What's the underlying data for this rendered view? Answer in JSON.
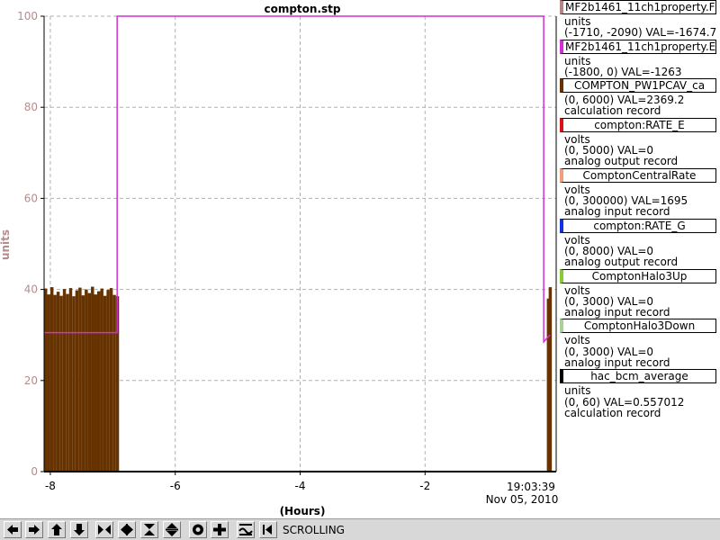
{
  "window": {
    "title": "compton.stp"
  },
  "chart_data": {
    "type": "line",
    "title": "compton.stp",
    "xlabel": "(Hours)",
    "ylabel": "units",
    "xlim": [
      -8.1,
      0.1
    ],
    "ylim": [
      0,
      100
    ],
    "x_ticks": [
      -8,
      -6,
      -4,
      -2
    ],
    "x_tick_labels": [
      "-8",
      "-6",
      "-4",
      "-2"
    ],
    "y_ticks": [
      0,
      20,
      40,
      60,
      80,
      100
    ],
    "y_tick_labels": [
      "0",
      "20",
      "40",
      "60",
      "80",
      "100"
    ],
    "grid": true,
    "legend": "right",
    "end_time": "19:03:39",
    "end_date": "Nov 05, 2010",
    "colors": {
      "axis_label": "#b48c8c",
      "line": "#d42ed4",
      "bars": "#663300"
    },
    "series": [
      {
        "name": "MF2b1461_11ch1property.E",
        "color": "#d42ed4",
        "x": [
          -8.1,
          -6.93,
          -6.93,
          -0.1,
          -0.1,
          0.0
        ],
        "y": [
          30.5,
          30.5,
          100,
          100,
          28.5,
          30
        ]
      },
      {
        "name": "COMPTON_PW1PCAV_ca",
        "color": "#663300",
        "x": [
          -8.1,
          -8.05,
          -8.0,
          -7.95,
          -7.9,
          -7.85,
          -7.8,
          -7.75,
          -7.7,
          -7.65,
          -7.6,
          -7.55,
          -7.5,
          -7.45,
          -7.4,
          -7.35,
          -7.3,
          -7.25,
          -7.2,
          -7.15,
          -7.1,
          -7.05,
          -7.0,
          -6.95,
          -0.05,
          -0.02
        ],
        "y": [
          40.2,
          38.9,
          40.5,
          38.8,
          39.5,
          38.6,
          40.1,
          39.0,
          40.3,
          38.5,
          39.8,
          40.4,
          38.7,
          40.0,
          39.2,
          40.6,
          38.9,
          39.6,
          40.2,
          38.6,
          39.9,
          40.3,
          38.8,
          38.5,
          38.0,
          40.5
        ]
      }
    ]
  },
  "legend": [
    {
      "name": "MF2b1461_11ch1property.F",
      "color": "#b88585",
      "lines": [
        "units",
        "(-1710, -2090) VAL=-1674.7"
      ]
    },
    {
      "name": "MF2b1461_11ch1property.E",
      "color": "#d42ed4",
      "lines": [
        "units",
        "(-1800, 0) VAL=-1263"
      ]
    },
    {
      "name": "COMPTON_PW1PCAV_ca",
      "color": "#663300",
      "lines": [
        "(0, 6000) VAL=2369.2",
        "calculation record"
      ]
    },
    {
      "name": "compton:RATE_E",
      "color": "#dd1111",
      "lines": [
        "volts",
        "(0, 5000) VAL=0",
        "analog output record"
      ]
    },
    {
      "name": "ComptonCentralRate",
      "color": "#f0a078",
      "lines": [
        "volts",
        "(0, 300000) VAL=1695",
        "analog input record"
      ]
    },
    {
      "name": "compton:RATE_G",
      "color": "#1133dd",
      "lines": [
        "volts",
        "(0, 8000) VAL=0",
        "analog output record"
      ]
    },
    {
      "name": "ComptonHalo3Up",
      "color": "#88cc33",
      "lines": [
        "volts",
        "(0, 3000) VAL=0",
        "analog input record"
      ]
    },
    {
      "name": "ComptonHalo3Down",
      "color": "#aad09a",
      "lines": [
        "volts",
        "(0, 3000) VAL=0",
        "analog input record"
      ]
    },
    {
      "name": "hac_bcm_average",
      "color": "#000000",
      "lines": [
        "units",
        "(0, 60) VAL=0.557012",
        "calculation record"
      ]
    }
  ],
  "toolbar": {
    "buttons": [
      {
        "name": "pan-left",
        "icon": "arrow-left-icon"
      },
      {
        "name": "pan-right",
        "icon": "arrow-right-icon"
      },
      {
        "name": "pan-up",
        "icon": "arrow-up-icon"
      },
      {
        "name": "pan-down",
        "icon": "arrow-down-icon"
      },
      {
        "name": "zoom-in-horizontal",
        "icon": "zoom-in-horizontal-icon"
      },
      {
        "name": "zoom-out-horizontal",
        "icon": "zoom-out-horizontal-icon"
      },
      {
        "name": "zoom-in-vertical",
        "icon": "zoom-in-vertical-icon"
      },
      {
        "name": "zoom-out-vertical",
        "icon": "zoom-out-vertical-icon"
      },
      {
        "name": "autoscale",
        "icon": "circle-target-icon"
      },
      {
        "name": "add",
        "icon": "plus-icon"
      },
      {
        "name": "wave-mode",
        "icon": "wave-icon"
      },
      {
        "name": "scroll-mode",
        "icon": "scroll-end-icon"
      }
    ],
    "status": "SCROLLING"
  }
}
